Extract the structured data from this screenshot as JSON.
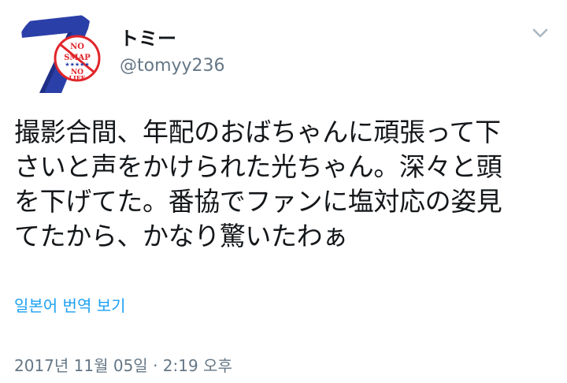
{
  "user": {
    "display_name": "トミー",
    "handle": "@tomyy236",
    "avatar_badge": "NO SMAP NO LIFE"
  },
  "header": {
    "menu_icon": "chevron-down-icon"
  },
  "tweet": {
    "text_lines": [
      "撮影合間、年配のおばちゃんに頑張って下",
      "さいと声をかけられた光ちゃん。深々と頭",
      "を下げてた。番協でファンに塩対応の姿見",
      "てたから、かなり驚いたわぁ"
    ],
    "translate_label": "일본어 번역 보기",
    "timestamp": "2017년 11월 05일 · 2:19 오후"
  },
  "colors": {
    "link": "#1da1f2",
    "secondary_text": "#657786",
    "avatar_blue": "#2b3fa8",
    "badge_red": "#e0262b"
  }
}
